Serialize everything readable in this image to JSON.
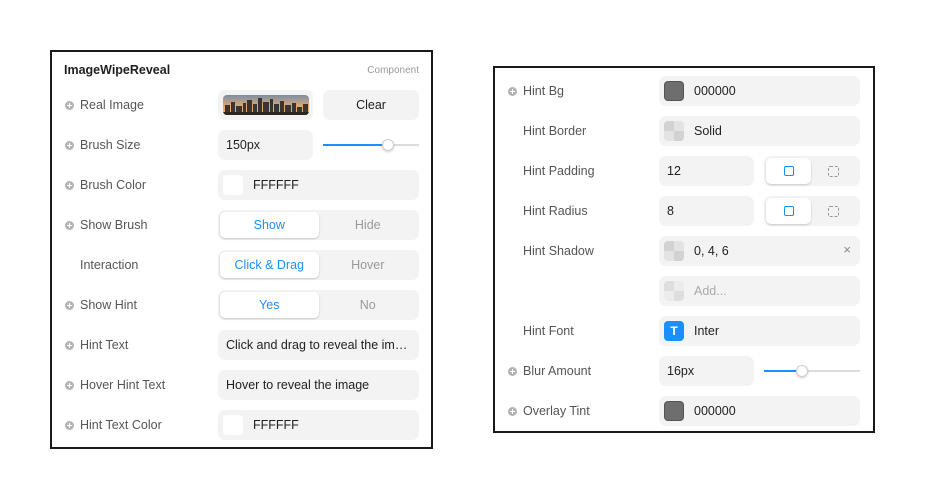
{
  "left_panel": {
    "title": "ImageWipeReveal",
    "type_label": "Component",
    "real_image_label": "Real Image",
    "clear_label": "Clear",
    "brush_size_label": "Brush Size",
    "brush_size_value": "150px",
    "brush_size_slider_level": 0.68,
    "brush_color_label": "Brush Color",
    "brush_color_value": "FFFFFF",
    "show_brush_label": "Show Brush",
    "show_brush_options": [
      "Show",
      "Hide"
    ],
    "interaction_label": "Interaction",
    "interaction_options": [
      "Click & Drag",
      "Hover"
    ],
    "show_hint_label": "Show Hint",
    "show_hint_options": [
      "Yes",
      "No"
    ],
    "hint_text_label": "Hint Text",
    "hint_text_value": "Click and drag to reveal the image",
    "hover_hint_text_label": "Hover Hint Text",
    "hover_hint_text_value": "Hover to reveal the image",
    "hint_text_color_label": "Hint Text Color",
    "hint_text_color_value": "FFFFFF"
  },
  "right_panel": {
    "hint_bg_label": "Hint Bg",
    "hint_bg_value": "000000",
    "hint_border_label": "Hint Border",
    "hint_border_value": "Solid",
    "hint_padding_label": "Hint Padding",
    "hint_padding_value": "12",
    "hint_radius_label": "Hint Radius",
    "hint_radius_value": "8",
    "hint_shadow_label": "Hint Shadow",
    "hint_shadow_value": "0, 4, 6",
    "add_placeholder": "Add...",
    "hint_font_label": "Hint Font",
    "hint_font_icon_glyph": "T",
    "hint_font_value": "Inter",
    "blur_amount_label": "Blur Amount",
    "blur_amount_value": "16px",
    "blur_amount_slider_level": 0.4,
    "overlay_tint_label": "Overlay Tint",
    "overlay_tint_value": "000000",
    "close_glyph": "×"
  },
  "colors": {
    "accent": "#1a8fff",
    "control_bg": "#f3f3f3",
    "panel_border": "#1a1a1a"
  }
}
